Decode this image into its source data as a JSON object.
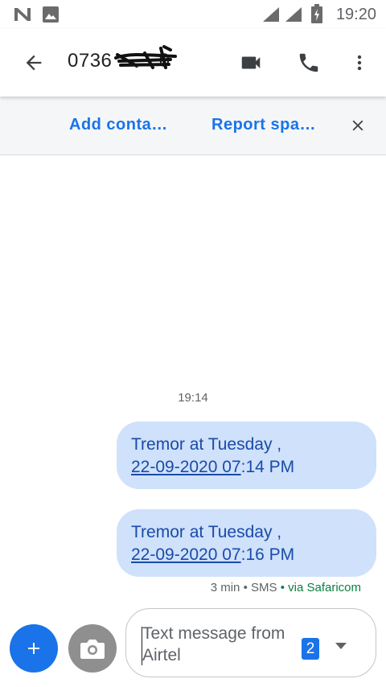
{
  "status_bar": {
    "time": "19:20",
    "icons": [
      "n-logo-icon",
      "image-icon",
      "signal-icon",
      "signal-icon",
      "battery-charging-icon"
    ]
  },
  "header": {
    "title": "0736           0",
    "icons": [
      "back-arrow-icon",
      "video-call-icon",
      "phone-icon",
      "more-vert-icon"
    ]
  },
  "actions": {
    "add_contact": "Add conta…",
    "report_spam": "Report spa…"
  },
  "conversation": {
    "timestamp": "19:14",
    "messages": [
      {
        "line1": "Tremor at Tuesday ,",
        "link": "22-09-2020 07",
        "rest": ":14 PM"
      },
      {
        "line1": "Tremor at Tuesday ,",
        "link": "22-09-2020 07",
        "rest": ":16 PM"
      }
    ],
    "meta": {
      "age": "3 min",
      "type": "SMS",
      "via": "via Safaricom"
    }
  },
  "composer": {
    "placeholder": "Text message from Airtel",
    "sim": "2"
  },
  "colors": {
    "accent": "#1a73e8",
    "bubble": "#cfe1fb",
    "bubble_text": "#1a4ba8",
    "carrier": "#0b8043"
  }
}
